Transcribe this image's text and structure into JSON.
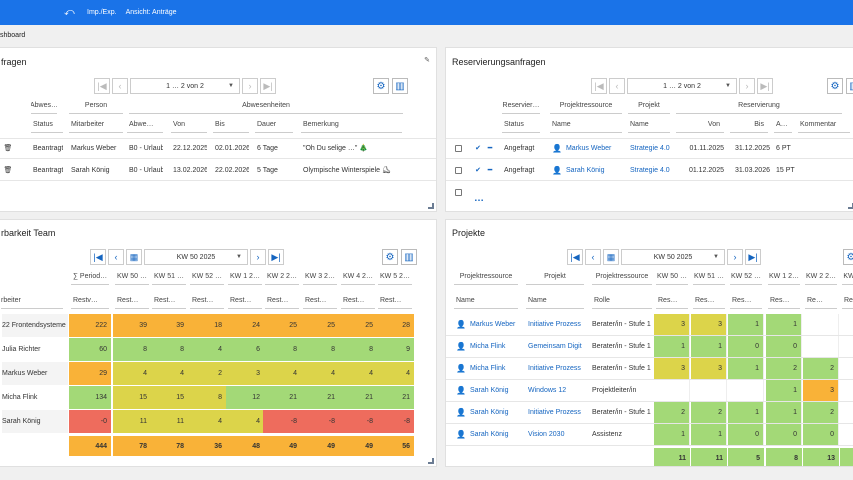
{
  "topbar": {
    "back_icon": "undo-icon",
    "link1": "Imp./Exp.",
    "link2": "Ansicht: Anträge"
  },
  "breadcrumb": "shboard",
  "absence": {
    "title": "fragen",
    "pager": "1 … 2 von 2",
    "group_headers": [
      "Abwes…",
      "Person",
      "Abwesenheiten"
    ],
    "col_headers": [
      "Status",
      "Mitarbeiter",
      "Abwe…",
      "Von",
      "Bis",
      "Dauer",
      "Bemerkung"
    ],
    "rows": [
      {
        "status": "Beantragt",
        "employee": "Markus Weber",
        "type": "B0 - Urlaub",
        "from": "22.12.2025",
        "to": "02.01.2026",
        "duration": "6 Tage",
        "remark": "\"Oh Du selige …\" 🎄"
      },
      {
        "status": "Beantragt",
        "employee": "Sarah König",
        "type": "B0 - Urlaub",
        "from": "13.02.2026",
        "to": "22.02.2026",
        "duration": "5 Tage",
        "remark": "Olympische Winterspiele ⛸"
      }
    ]
  },
  "reservation": {
    "title": "Reservierungsanfragen",
    "pager": "1 … 2 von 2",
    "group_headers": [
      "Reservier…",
      "Projektressource",
      "Projekt",
      "Reservierung"
    ],
    "col_headers": [
      "Status",
      "Name",
      "Name",
      "Von",
      "Bis",
      "A…",
      "Kommentar"
    ],
    "rows": [
      {
        "status": "Angefragt",
        "name": "Markus Weber",
        "project": "Strategie 4.0",
        "from": "01.11.2025",
        "to": "31.12.2025",
        "amount": "6 PT"
      },
      {
        "status": "Angefragt",
        "name": "Sarah König",
        "project": "Strategie 4.0",
        "from": "01.12.2025",
        "to": "31.03.2026",
        "amount": "15 PT"
      }
    ],
    "more": "…"
  },
  "team": {
    "title": "rbarkeit  Team",
    "week": "KW 50 2025",
    "col_headers": [
      "∑ Period…",
      "KW 50 …",
      "KW 51 …",
      "KW 52 …",
      "KW 1 2…",
      "KW 2 2…",
      "KW 3 2…",
      "KW 4 2…",
      "KW 5 2…"
    ],
    "sub_headers": [
      "rbeiter",
      "Restv…",
      "Rest…",
      "Rest…",
      "Rest…",
      "Rest…",
      "Rest…",
      "Rest…",
      "Rest…",
      "Rest…"
    ],
    "rows": [
      {
        "name": "22 Frontendsysteme",
        "values": [
          "222",
          "39",
          "39",
          "18",
          "24",
          "25",
          "25",
          "25",
          "28"
        ],
        "colors": [
          "or",
          "or",
          "or",
          "or",
          "or",
          "or",
          "or",
          "or",
          "or"
        ]
      },
      {
        "name": "Julia Richter",
        "values": [
          "60",
          "8",
          "8",
          "4",
          "6",
          "8",
          "8",
          "8",
          "9"
        ],
        "colors": [
          "gn",
          "gn",
          "gn",
          "gn",
          "gn",
          "gn",
          "gn",
          "gn",
          "gn"
        ]
      },
      {
        "name": "Markus Weber",
        "values": [
          "29",
          "4",
          "4",
          "2",
          "3",
          "4",
          "4",
          "4",
          "4"
        ],
        "colors": [
          "or",
          "ye",
          "ye",
          "ye",
          "ye",
          "ye",
          "ye",
          "ye",
          "ye"
        ]
      },
      {
        "name": "Micha Flink",
        "values": [
          "134",
          "15",
          "15",
          "8",
          "12",
          "21",
          "21",
          "21",
          "21"
        ],
        "colors": [
          "gn",
          "ye",
          "ye",
          "ye",
          "gn",
          "gn",
          "gn",
          "gn",
          "gn"
        ]
      },
      {
        "name": "Sarah König",
        "values": [
          "-0",
          "11",
          "11",
          "4",
          "4",
          "-8",
          "-8",
          "-8",
          "-8"
        ],
        "colors": [
          "rd",
          "ye",
          "ye",
          "ye",
          "ye",
          "rd",
          "rd",
          "rd",
          "rd"
        ]
      }
    ],
    "totals": [
      "444",
      "78",
      "78",
      "36",
      "48",
      "49",
      "49",
      "49",
      "56"
    ]
  },
  "projects": {
    "title": "Projekte",
    "week": "KW 50 2025",
    "group_headers": [
      "Projektressource",
      "Projekt",
      "Projektressource",
      "KW 50 …",
      "KW 51 …",
      "KW 52 …",
      "KW 1 2…",
      "KW 2 2…",
      "KW"
    ],
    "col_headers": [
      "Name",
      "Name",
      "Rolle",
      "Res…",
      "Res…",
      "Res…",
      "Res…",
      "Re…",
      "Re"
    ],
    "rows": [
      {
        "name": "Markus Weber",
        "project": "Initiative Prozess",
        "role": "Berater/in - Stufe 1",
        "values": [
          "",
          "3",
          "3",
          "1",
          "1",
          "",
          ""
        ]
      },
      {
        "name": "Micha Flink",
        "project": "Gemeinsam Digit",
        "role": "Berater/in - Stufe 1",
        "values": [
          "",
          "1",
          "1",
          "0",
          "0",
          "",
          ""
        ]
      },
      {
        "name": "Micha Flink",
        "project": "Initiative Prozess",
        "role": "Berater/in - Stufe 1",
        "values": [
          "",
          "3",
          "3",
          "1",
          "2",
          "2",
          ""
        ]
      },
      {
        "name": "Sarah König",
        "project": "Windows 12",
        "role": "Projektleiter/in",
        "values": [
          "",
          "",
          "",
          "",
          "1",
          "3",
          ""
        ]
      },
      {
        "name": "Sarah König",
        "project": "Initiative Prozess",
        "role": "Berater/in - Stufe 1",
        "values": [
          "",
          "2",
          "2",
          "1",
          "1",
          "2",
          ""
        ]
      },
      {
        "name": "Sarah König",
        "project": "Vision 2030",
        "role": "Assistenz",
        "values": [
          "",
          "1",
          "1",
          "0",
          "0",
          "0",
          ""
        ]
      }
    ],
    "totals": [
      "11",
      "11",
      "5",
      "8",
      "13",
      ""
    ]
  }
}
